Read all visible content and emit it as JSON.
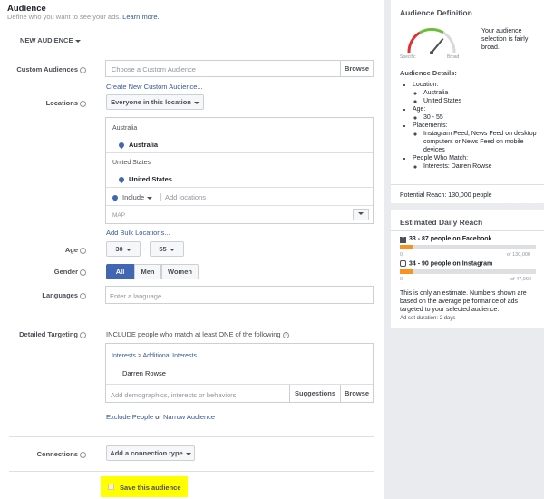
{
  "header": {
    "title": "Audience",
    "subtitle": "Define who you want to see your ads.",
    "learn_more": "Learn more."
  },
  "audience_selector": "NEW AUDIENCE",
  "custom_audiences": {
    "label": "Custom Audiences",
    "placeholder": "Choose a Custom Audience",
    "browse": "Browse",
    "create_link": "Create New Custom Audience..."
  },
  "locations": {
    "label": "Locations",
    "dropdown": "Everyone in this location",
    "groups": [
      {
        "country_header": "Australia",
        "item": "Australia"
      },
      {
        "country_header": "United States",
        "item": "United States"
      }
    ],
    "include": "Include",
    "add_placeholder": "Add locations",
    "map_label": "MAP",
    "bulk_link": "Add Bulk Locations..."
  },
  "age": {
    "label": "Age",
    "from": "30",
    "to": "55",
    "dash": "-"
  },
  "gender": {
    "label": "Gender",
    "options": [
      "All",
      "Men",
      "Women"
    ],
    "selected": "All"
  },
  "languages": {
    "label": "Languages",
    "placeholder": "Enter a language..."
  },
  "detailed_targeting": {
    "label": "Detailed Targeting",
    "description": "INCLUDE people who match at least ONE of the following",
    "breadcrumb_a": "Interests",
    "breadcrumb_sep": ">",
    "breadcrumb_b": "Additional Interests",
    "item": "Darren Rowse",
    "placeholder": "Add demographics, interests or behaviors",
    "suggestions": "Suggestions",
    "browse": "Browse",
    "exclude_link": "Exclude People",
    "or_text": "or",
    "narrow_link": "Narrow Audience"
  },
  "connections": {
    "label": "Connections",
    "dropdown": "Add a connection type"
  },
  "save_audience": "Save this audience",
  "audience_definition": {
    "title": "Audience Definition",
    "gauge_description": "Your audience selection is fairly broad.",
    "gauge_low": "Specific",
    "gauge_high": "Broad",
    "gauge_level": 0.72,
    "details_title": "Audience Details:",
    "details": {
      "location_label": "Location:",
      "locations": [
        "Australia",
        "United States"
      ],
      "age_label": "Age:",
      "age_value": "30 - 55",
      "placements_label": "Placements:",
      "placements_value": "Instagram Feed, News Feed on desktop computers or News Feed on mobile devices",
      "match_label": "People Who Match:",
      "match_value": "Interests: Darren Rowse"
    },
    "potential_reach": "Potential Reach: 130,000 people"
  },
  "daily_reach": {
    "title": "Estimated Daily Reach",
    "facebook": {
      "text": "33 - 87 people on Facebook",
      "min": "0",
      "max": "of 130,000",
      "fraction": 0.1
    },
    "instagram": {
      "text": "34 - 90 people on Instagram",
      "min": "0",
      "max": "of 47,000",
      "fraction": 0.1
    },
    "note": "This is only an estimate. Numbers shown are based on the average performance of ads targeted to your selected audience.",
    "duration": "Ad set duration: 2 days"
  },
  "colors": {
    "link": "#365899",
    "accent": "#4267b2",
    "highlight": "#ffff00",
    "bar": "#f7931e"
  }
}
